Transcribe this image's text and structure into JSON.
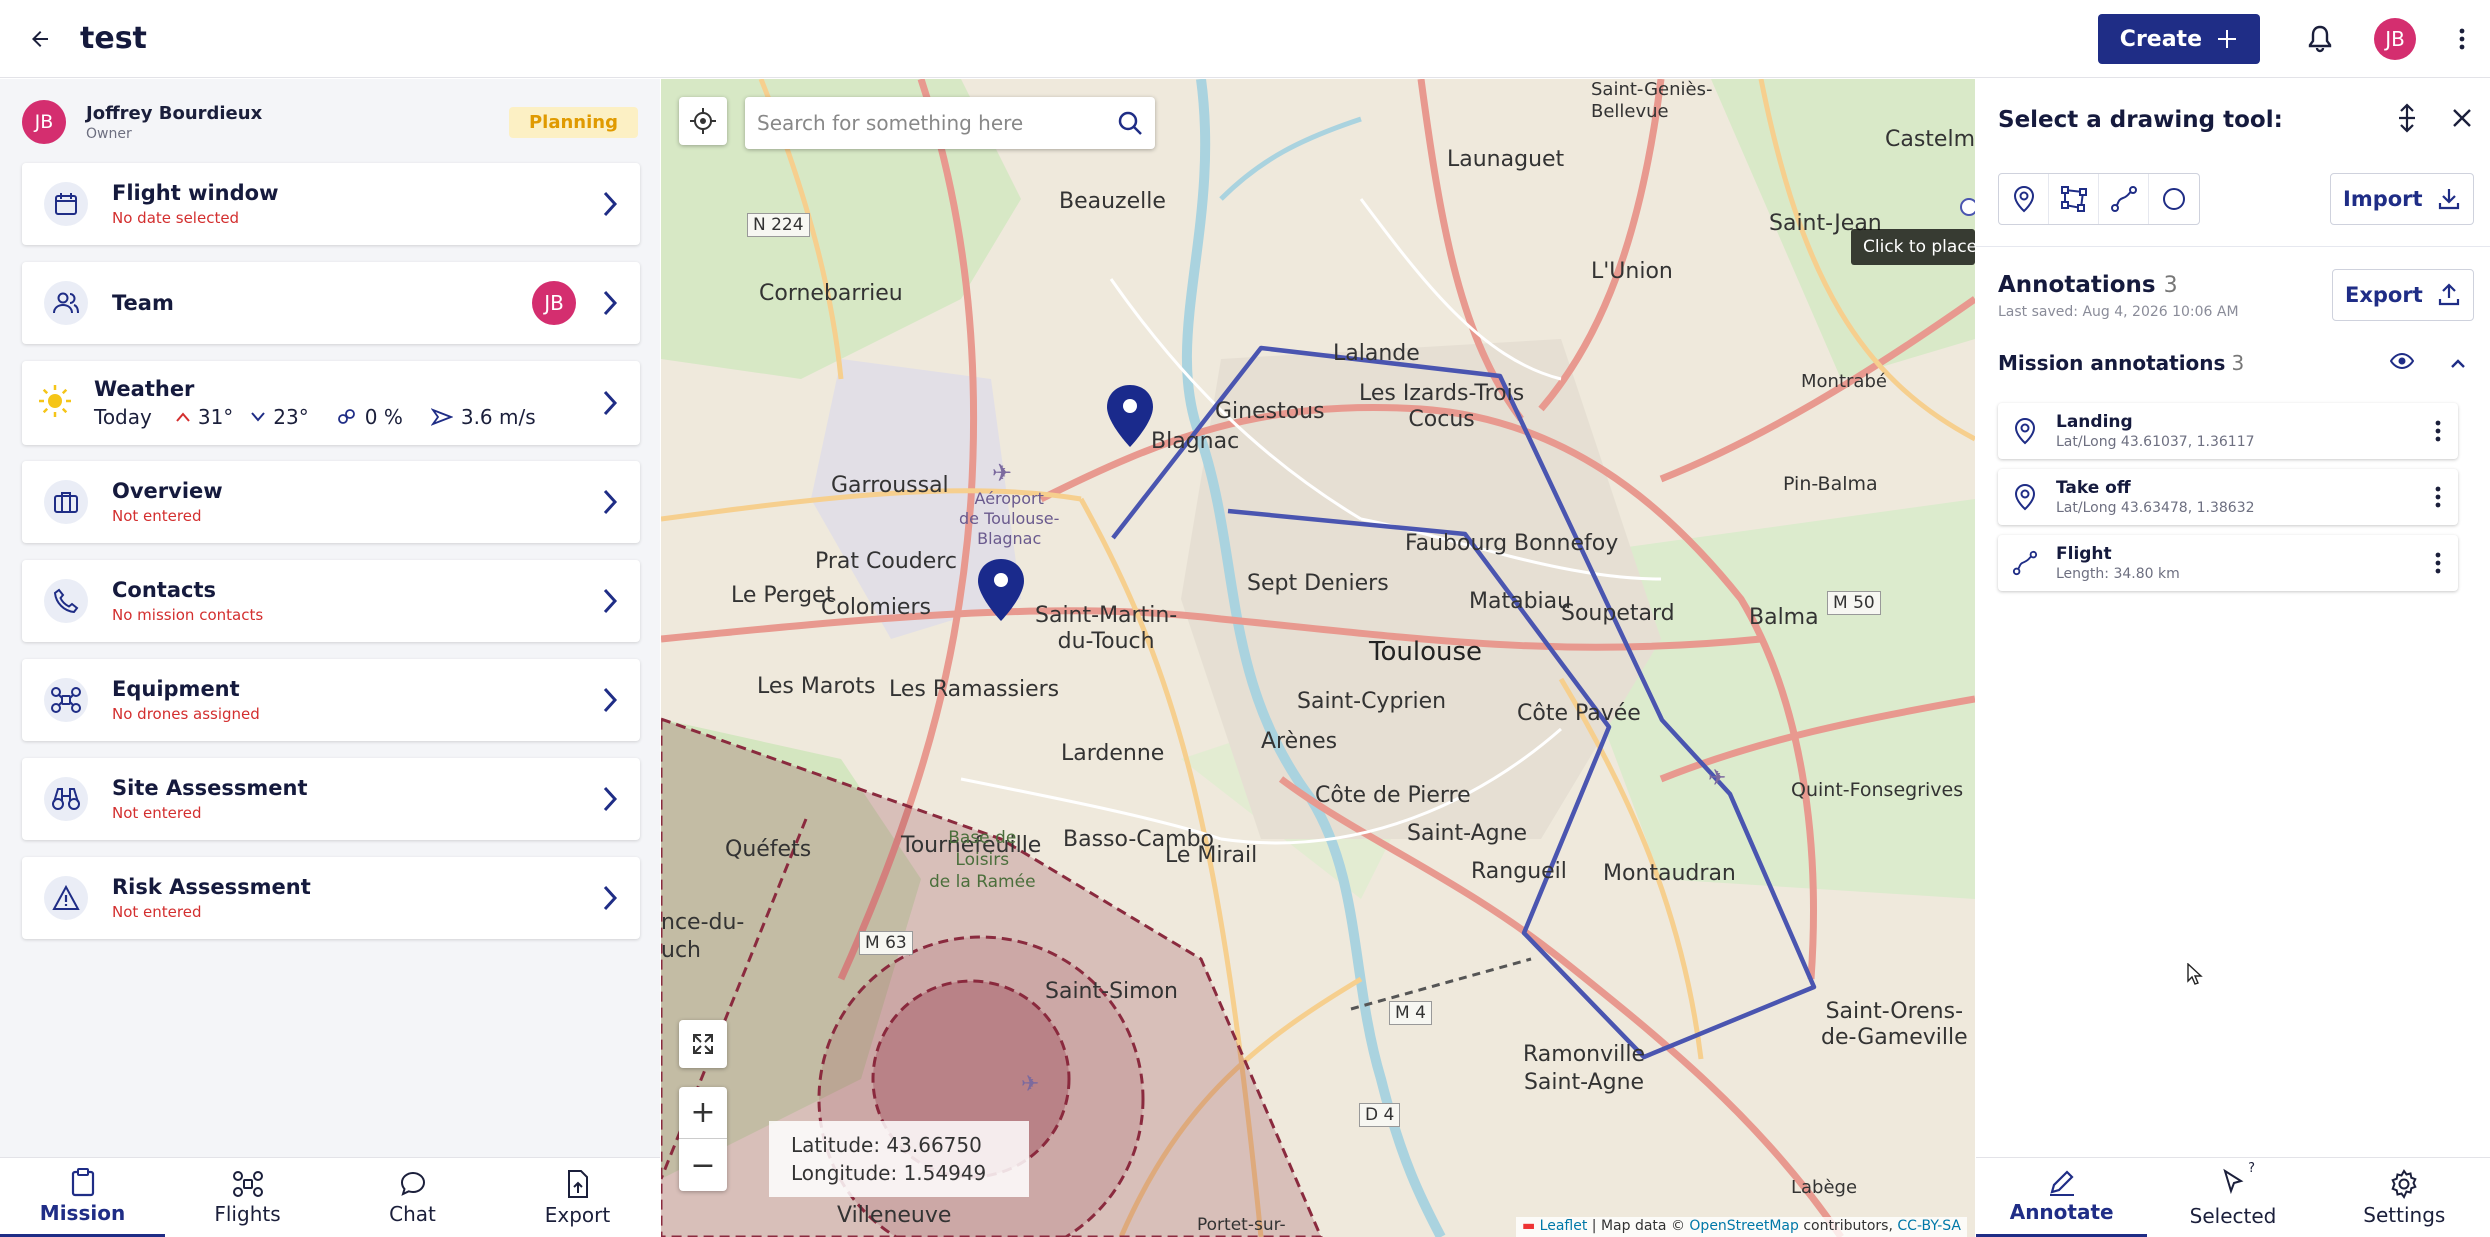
{
  "header": {
    "title": "test",
    "create_label": "Create",
    "user_initials": "JB"
  },
  "owner": {
    "initials": "JB",
    "name": "Joffrey Bourdieux",
    "role": "Owner",
    "status": "Planning"
  },
  "cards": {
    "flight_window": {
      "title": "Flight window",
      "sub": "No date selected"
    },
    "team": {
      "title": "Team",
      "member_initials": "JB"
    },
    "weather": {
      "title": "Weather",
      "day": "Today",
      "high": "31°",
      "low": "23°",
      "precip": "0 %",
      "wind": "3.6 m/s"
    },
    "overview": {
      "title": "Overview",
      "sub": "Not entered"
    },
    "contacts": {
      "title": "Contacts",
      "sub": "No mission contacts"
    },
    "equipment": {
      "title": "Equipment",
      "sub": "No drones assigned"
    },
    "site_assessment": {
      "title": "Site Assessment",
      "sub": "Not entered"
    },
    "risk_assessment": {
      "title": "Risk Assessment",
      "sub": "Not entered"
    }
  },
  "bottom_nav": {
    "mission": "Mission",
    "flights": "Flights",
    "chat": "Chat",
    "export": "Export"
  },
  "map": {
    "search_placeholder": "Search for something here",
    "latitude": "Latitude: 43.66750",
    "longitude": "Longitude: 1.54949",
    "tooltip": "Click to place t",
    "attr_leaflet": "Leaflet",
    "attr_mapdata": "| Map data ©",
    "attr_osm": "OpenStreetMap",
    "attr_contrib": "contributors,",
    "attr_license": "CC-BY-SA",
    "labels": {
      "toulouse": "Toulouse",
      "blagnac": "Blagnac",
      "colomiers": "Colomiers",
      "tournefeuille": "Tournefeuille",
      "balma": "Balma",
      "lunion": "L'Union",
      "saint_jean": "Saint-Jean",
      "launaguet": "Launaguet",
      "castelmaurou": "Castelmaurou",
      "saint_genies": "Saint-Geniès-\nBellevue",
      "beauzelle": "Beauzelle",
      "cornebarrieu": "Cornebarrieu",
      "garroussal": "Garroussal",
      "pratcouderc": "Prat Couderc",
      "leperget": "Le Perget",
      "lesmarots": "Les Marots",
      "lesramassiers": "Les Ramassiers",
      "lardenne": "Lardenne",
      "quefets": "Quéfets",
      "bassocambo": "Basso-Cambo",
      "lemirail": "Le Mirail",
      "arenes": "Arènes",
      "saintcyprien": "Saint-Cyprien",
      "septdeniers": "Sept Deniers",
      "ginestous": "Ginestous",
      "lalande": "Lalande",
      "izards": "Les Izards-Trois\nCocus",
      "faubourg": "Faubourg Bonnefoy",
      "matabiau": "Matabiau",
      "soupetard": "Soupetard",
      "cotepavee": "Côte Pavée",
      "montaudran": "Montaudran",
      "rangueil": "Rangueil",
      "saintagne": "Saint-Agne",
      "cotepierre": "Côte de Pierre",
      "ramonville": "Ramonville\nSaint-Agne",
      "saintsimon": "Saint-Simon",
      "quint": "Quint-Fonsegrives",
      "saintorens": "Saint-Orens-\nde-Gameville",
      "pinbalma": "Pin-Balma",
      "montrabe": "Montrabé",
      "villeneuve": "Villeneuve",
      "labege": "Labège",
      "portet": "Portet-sur-",
      "baseloisirs": "Base de\nLoisirs\nde la Ramée",
      "aeroport": "Aéroport\nde Toulouse-\nBlagnac",
      "saintmartin": "Saint-Martin-\ndu-Touch",
      "cedu": "nce-du-\nuch",
      "n224": "N 224",
      "m63": "M 63",
      "m50": "M 50",
      "m4": "M 4",
      "d4": "D 4"
    }
  },
  "right_panel": {
    "title": "Select a drawing tool:",
    "import_label": "Import",
    "export_label": "Export",
    "annotations_title": "Annotations",
    "annotations_count": "3",
    "last_saved": "Last saved: Aug 4, 2026 10:06 AM",
    "mission_annotations_title": "Mission annotations",
    "mission_annotations_count": "3",
    "items": [
      {
        "name": "Landing",
        "sub": "Lat/Long 43.61037, 1.36117",
        "icon": "location-pin-icon"
      },
      {
        "name": "Take off",
        "sub": "Lat/Long 43.63478, 1.38632",
        "icon": "location-pin-icon"
      },
      {
        "name": "Flight",
        "sub": "Length: 34.80 km",
        "icon": "path-line-icon"
      }
    ],
    "nav": {
      "annotate": "Annotate",
      "selected": "Selected",
      "selected_count": "?",
      "settings": "Settings"
    }
  },
  "colors": {
    "brand": "#1f2d86",
    "avatar": "#d42e6f",
    "error": "#d32f2f",
    "planning": "#e09a00",
    "flight_path": "#4a55b0",
    "restricted_zone": "#8a2a3e"
  }
}
